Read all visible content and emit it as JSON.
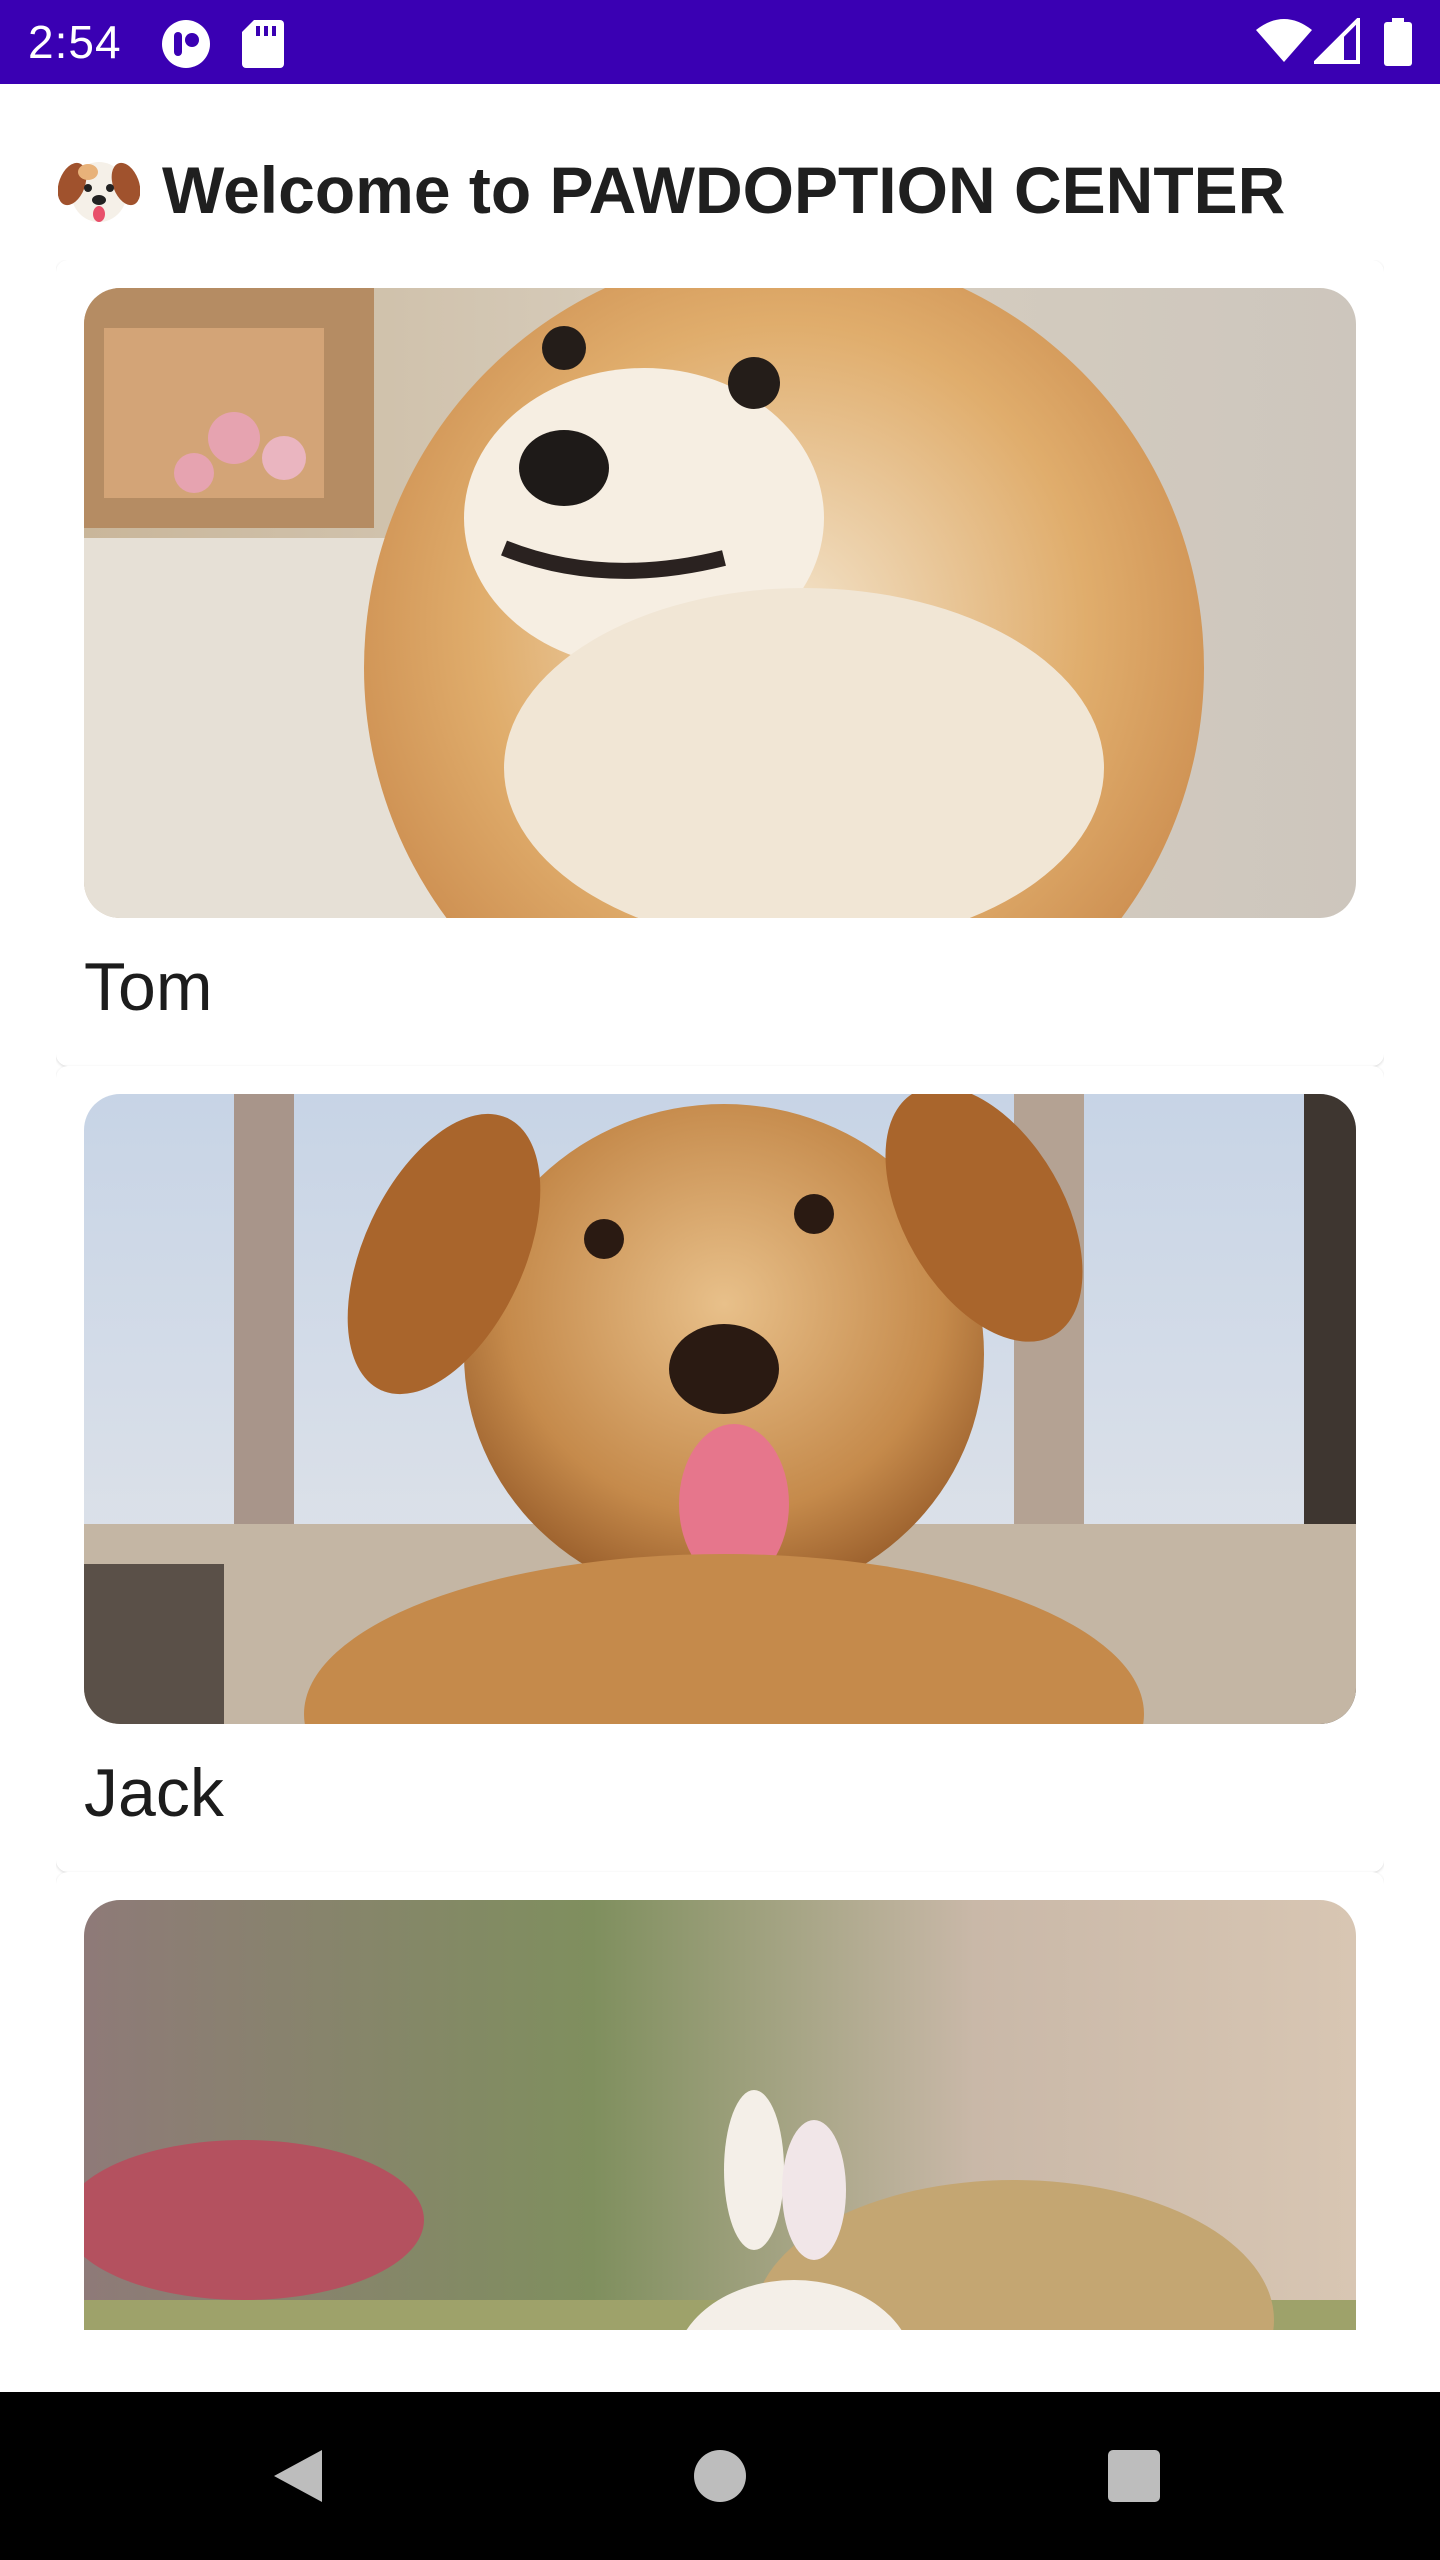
{
  "status_bar": {
    "time": "2:54",
    "background": "#3a00b3",
    "left_icons": [
      "notification-app-icon",
      "sd-card-icon"
    ],
    "right_icons": [
      "wifi-icon",
      "cell-signal-icon",
      "battery-icon"
    ]
  },
  "header": {
    "emoji": "🐶",
    "title": "Welcome to PAWDOPTION CENTER"
  },
  "pets": [
    {
      "name": "Tom",
      "photo": "shiba-inu-dog-photo"
    },
    {
      "name": "Jack",
      "photo": "brown-puppy-photo"
    },
    {
      "name": "",
      "photo": "pomeranian-in-bunny-hat-photo"
    }
  ],
  "nav_bar": {
    "buttons": [
      "back-icon",
      "home-icon",
      "recents-icon"
    ]
  }
}
